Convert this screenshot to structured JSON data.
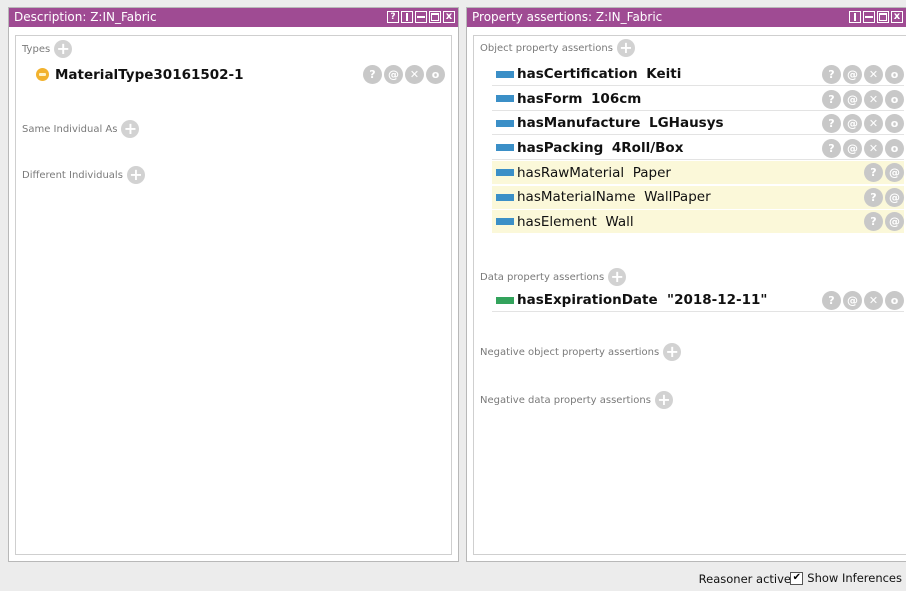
{
  "description_panel": {
    "title": "Description: Z:IN_Fabric",
    "types_label": "Types",
    "types": [
      {
        "label": "MaterialType30161502-1"
      }
    ],
    "same_individual_label": "Same Individual As",
    "different_individuals_label": "Different Individuals"
  },
  "property_panel": {
    "title": "Property assertions: Z:IN_Fabric",
    "object_label": "Object property assertions",
    "object_assertions": [
      {
        "property": "hasCertification",
        "value": "Keiti",
        "inferred": false
      },
      {
        "property": "hasForm",
        "value": "106cm",
        "inferred": false
      },
      {
        "property": "hasManufacture",
        "value": "LGHausys",
        "inferred": false
      },
      {
        "property": "hasPacking",
        "value": "4Roll/Box",
        "inferred": false
      },
      {
        "property": "hasRawMaterial",
        "value": "Paper",
        "inferred": true
      },
      {
        "property": "hasMaterialName",
        "value": "WallPaper",
        "inferred": true
      },
      {
        "property": "hasElement",
        "value": "Wall",
        "inferred": true
      }
    ],
    "data_label": "Data property assertions",
    "data_assertions": [
      {
        "property": "hasExpirationDate",
        "value": "\"2018-12-11\""
      }
    ],
    "neg_object_label": "Negative object property assertions",
    "neg_data_label": "Negative data property assertions"
  },
  "icons": {
    "add": "+",
    "explain": "?",
    "annotate": "@",
    "delete": "✕",
    "edit": "o",
    "help": "?",
    "close": "x",
    "check": "✔"
  },
  "status": {
    "reasoner": "Reasoner active",
    "show_inferences": "Show Inferences",
    "show_inferences_checked": true
  },
  "colors": {
    "title_bar": "#9f4b93",
    "object_property": "#3b8fc7",
    "data_property": "#33a35c",
    "inferred_bg": "#fbf8d9",
    "individual": "#f2b22e"
  }
}
